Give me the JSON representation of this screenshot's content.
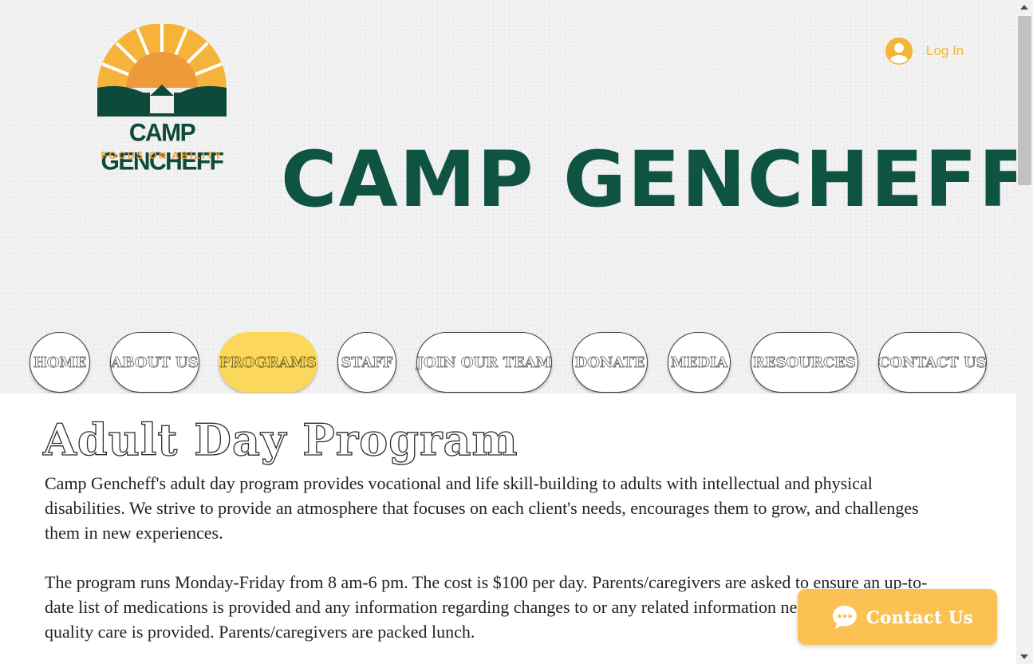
{
  "header": {
    "logo": {
      "title": "CAMP GENCHEFF",
      "tagline": "FOCUS ON ABILITY"
    },
    "site_title": "CAMP GENCHEFF",
    "login": {
      "label": "Log In",
      "icon": "user-avatar-icon"
    }
  },
  "nav": {
    "items": [
      {
        "label": "HOME"
      },
      {
        "label": "ABOUT US"
      },
      {
        "label": "PROGRAMS",
        "active": true
      },
      {
        "label": "STAFF"
      },
      {
        "label": "JOIN OUR TEAM"
      },
      {
        "label": "DONATE"
      },
      {
        "label": "MEDIA"
      },
      {
        "label": "RESOURCES"
      },
      {
        "label": "CONTACT US"
      }
    ]
  },
  "main": {
    "heading": "Adult Day Program",
    "paragraphs": [
      "Camp Gencheff's adult day program provides vocational and life skill-building to adults with intellectual and physical disabilities.  We strive to provide an atmosphere that focuses on each client's needs, encourages them to grow, and challenges them in new experiences.",
      "The program runs Monday-Friday from 8 am-6 pm.  The cost is $100 per day.  Parents/caregivers are asked to ensure an up-to-date list of medications is provided and any information regarding changes to or any related information necessary to ensure quality care is provided.  Parents/caregivers are packed lunch."
    ]
  },
  "contact_widget": {
    "label": "Contact Us",
    "icon": "chat-bubble-icon"
  },
  "colors": {
    "brand_green": "#0f5443",
    "brand_orange": "#f4a23a",
    "accent_yellow": "#fbd85a",
    "widget_yellow": "#fbc152",
    "login_yellow": "#f4b436"
  }
}
